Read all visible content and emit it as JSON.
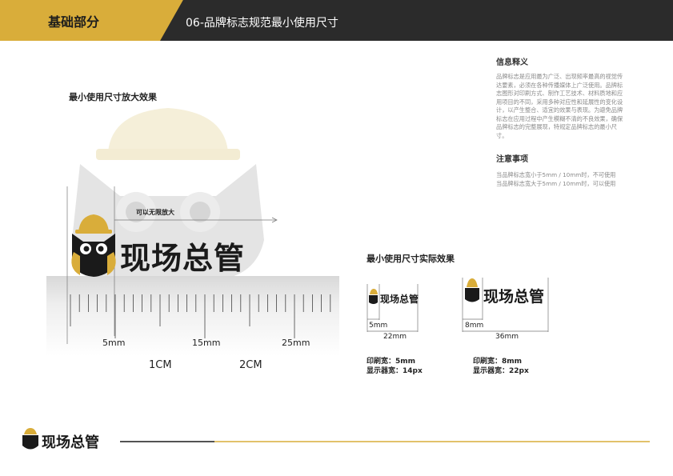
{
  "header": {
    "section": "基础部分",
    "subtitle": "06-品牌标志规范最小使用尺寸"
  },
  "info": {
    "title": "信息释义",
    "body": "品牌标志是应用最为广泛、出现频率最高的视觉传达要素，必须在各种传播媒体上广泛使用。品牌标志图形对印刷方式、制作工艺技术、材料质地和应用项目的不同，采用多种对应性和延展性的变化设计，以产生整合、适宜的效果与表现。为避免品牌标志在应用过程中产生模糊不清的不良效果，确保品牌标志的完整展现，特规定品牌标志的最小尺寸。",
    "note_title": "注意事项",
    "note_lines": [
      "当品牌标志宽小于5mm / 10mm时，不可使用",
      "当品牌标志宽大于5mm / 10mm时，可以使用"
    ]
  },
  "zoom": {
    "title": "最小使用尺寸放大效果",
    "arrow_label": "可以无限放大",
    "logo_text": "现场总管",
    "ruler_small": [
      "5mm",
      "15mm",
      "25mm"
    ],
    "ruler_big": [
      "1CM",
      "2CM"
    ]
  },
  "actual": {
    "title": "最小使用尺寸实际效果",
    "items": [
      {
        "logo_text": "现场总管",
        "inner": "5mm",
        "outer": "22mm",
        "print": "印刷宽：5mm",
        "screen": "显示器宽：14px"
      },
      {
        "logo_text": "现场总管",
        "inner": "8mm",
        "outer": "36mm",
        "print": "印刷宽：8mm",
        "screen": "显示器宽：22px"
      }
    ]
  },
  "footer": {
    "logo_text": "现场总管"
  },
  "colors": {
    "gold": "#d9ad3a",
    "dark": "#2b2b2b",
    "black": "#1a1a1a"
  }
}
